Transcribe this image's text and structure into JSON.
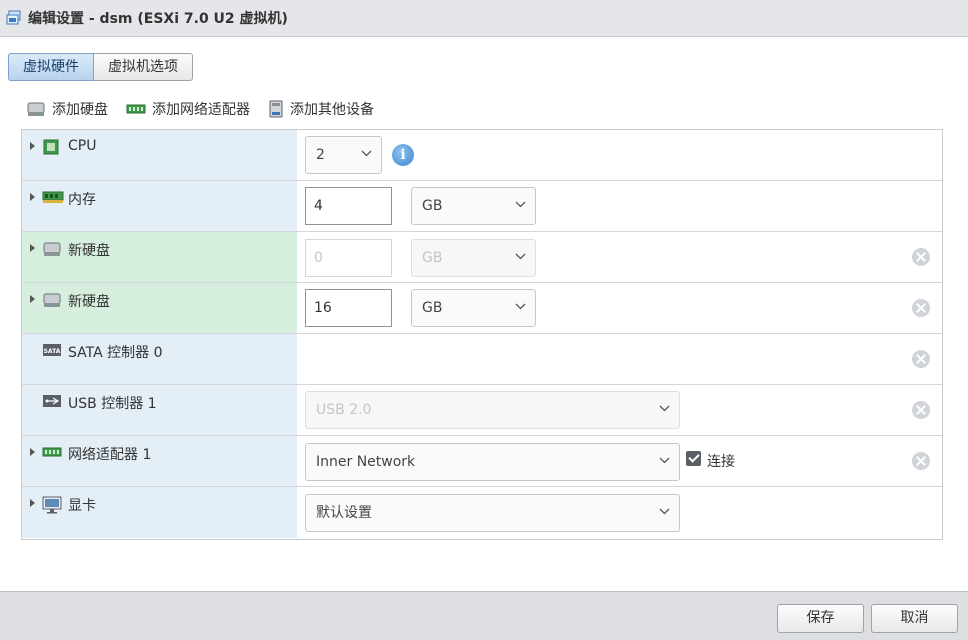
{
  "window": {
    "title": "编辑设置 - dsm (ESXi 7.0 U2 虚拟机)"
  },
  "tabs": [
    {
      "label": "虚拟硬件",
      "active": true
    },
    {
      "label": "虚拟机选项",
      "active": false
    }
  ],
  "toolbar": {
    "add_disk": "添加硬盘",
    "add_network_adapter": "添加网络适配器",
    "add_other_device": "添加其他设备"
  },
  "hardware": {
    "cpu": {
      "label": "CPU",
      "value": "2"
    },
    "memory": {
      "label": "内存",
      "value": "4",
      "unit": "GB"
    },
    "new_disk_1": {
      "label": "新硬盘",
      "placeholder": "0",
      "unit": "GB"
    },
    "new_disk_2": {
      "label": "新硬盘",
      "value": "16",
      "unit": "GB"
    },
    "sata": {
      "label": "SATA 控制器 0"
    },
    "usb": {
      "label": "USB 控制器 1",
      "value": "USB 2.0"
    },
    "network": {
      "label": "网络适配器 1",
      "value": "Inner Network",
      "connect_label": "连接",
      "connected": true
    },
    "display": {
      "label": "显卡",
      "value": "默认设置"
    }
  },
  "buttons": {
    "save": "保存",
    "cancel": "取消"
  },
  "icons": {
    "title": "vm-window-icon",
    "info": "info-icon",
    "remove": "remove-circle-icon"
  },
  "colors": {
    "label_bg": "#e4eef6",
    "new_device_bg": "#d6eedd",
    "active_tab": "#b8d3ef",
    "info_blue": "#3b86cf"
  }
}
